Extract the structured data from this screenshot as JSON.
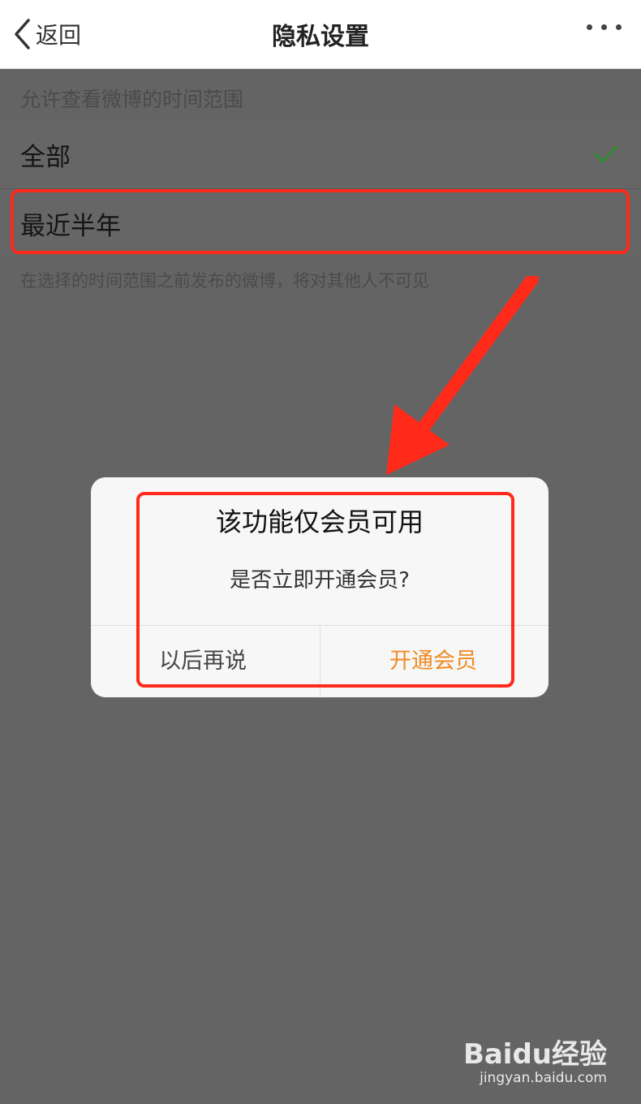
{
  "navbar": {
    "back_label": "返回",
    "title": "隐私设置"
  },
  "settings": {
    "section_header": "允许查看微博的时间范围",
    "options": [
      {
        "label": "全部",
        "selected": true
      },
      {
        "label": "最近半年",
        "selected": false
      }
    ],
    "footnote": "在选择的时间范围之前发布的微博，将对其他人不可见"
  },
  "dialog": {
    "title": "该功能仅会员可用",
    "message": "是否立即开通会员?",
    "cancel_label": "以后再说",
    "confirm_label": "开通会员"
  },
  "watermark": {
    "logo": "Baidu经验",
    "url": "jingyan.baidu.com"
  },
  "colors": {
    "accent_orange": "#f08a24",
    "check_green": "#2e8b2e",
    "annotation_red": "#ff2a1a",
    "overlay_gray": "#646464"
  },
  "icons": {
    "back": "chevron-left-icon",
    "more": "more-dots-icon",
    "check": "checkmark-icon"
  }
}
